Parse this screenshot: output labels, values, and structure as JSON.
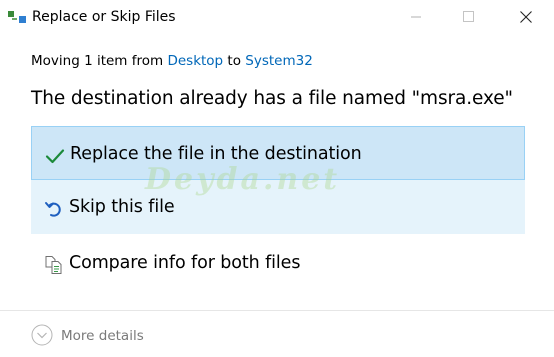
{
  "window": {
    "title": "Replace or Skip Files",
    "app_icon": "file-move-icon",
    "controls": {
      "minimize_icon": "minimize-icon",
      "maximize_icon": "maximize-icon",
      "close_icon": "close-icon"
    }
  },
  "header": {
    "moving_prefix": "Moving 1 item from ",
    "source": "Desktop",
    "to_word": " to ",
    "destination": "System32",
    "conflict_message": "The destination already has a file named \"msra.exe\""
  },
  "options": [
    {
      "label": "Replace the file in the destination",
      "icon": "checkmark-icon",
      "state": "selected"
    },
    {
      "label": "Skip this file",
      "icon": "skip-arrow-icon",
      "state": "hover"
    },
    {
      "label": "Compare info for both files",
      "icon": "compare-files-icon",
      "state": "normal"
    }
  ],
  "footer": {
    "more_details_label": "More details",
    "more_details_icon": "chevron-down-circle-icon"
  },
  "watermark": {
    "text": "Deyda.net"
  },
  "colors": {
    "link": "#0067b8",
    "selected_bg": "#cde6f7",
    "selected_border": "#99d1f5",
    "hover_bg": "#e5f3fb",
    "checkmark": "#1b8a3a",
    "muted_text": "#7a7a7a"
  }
}
